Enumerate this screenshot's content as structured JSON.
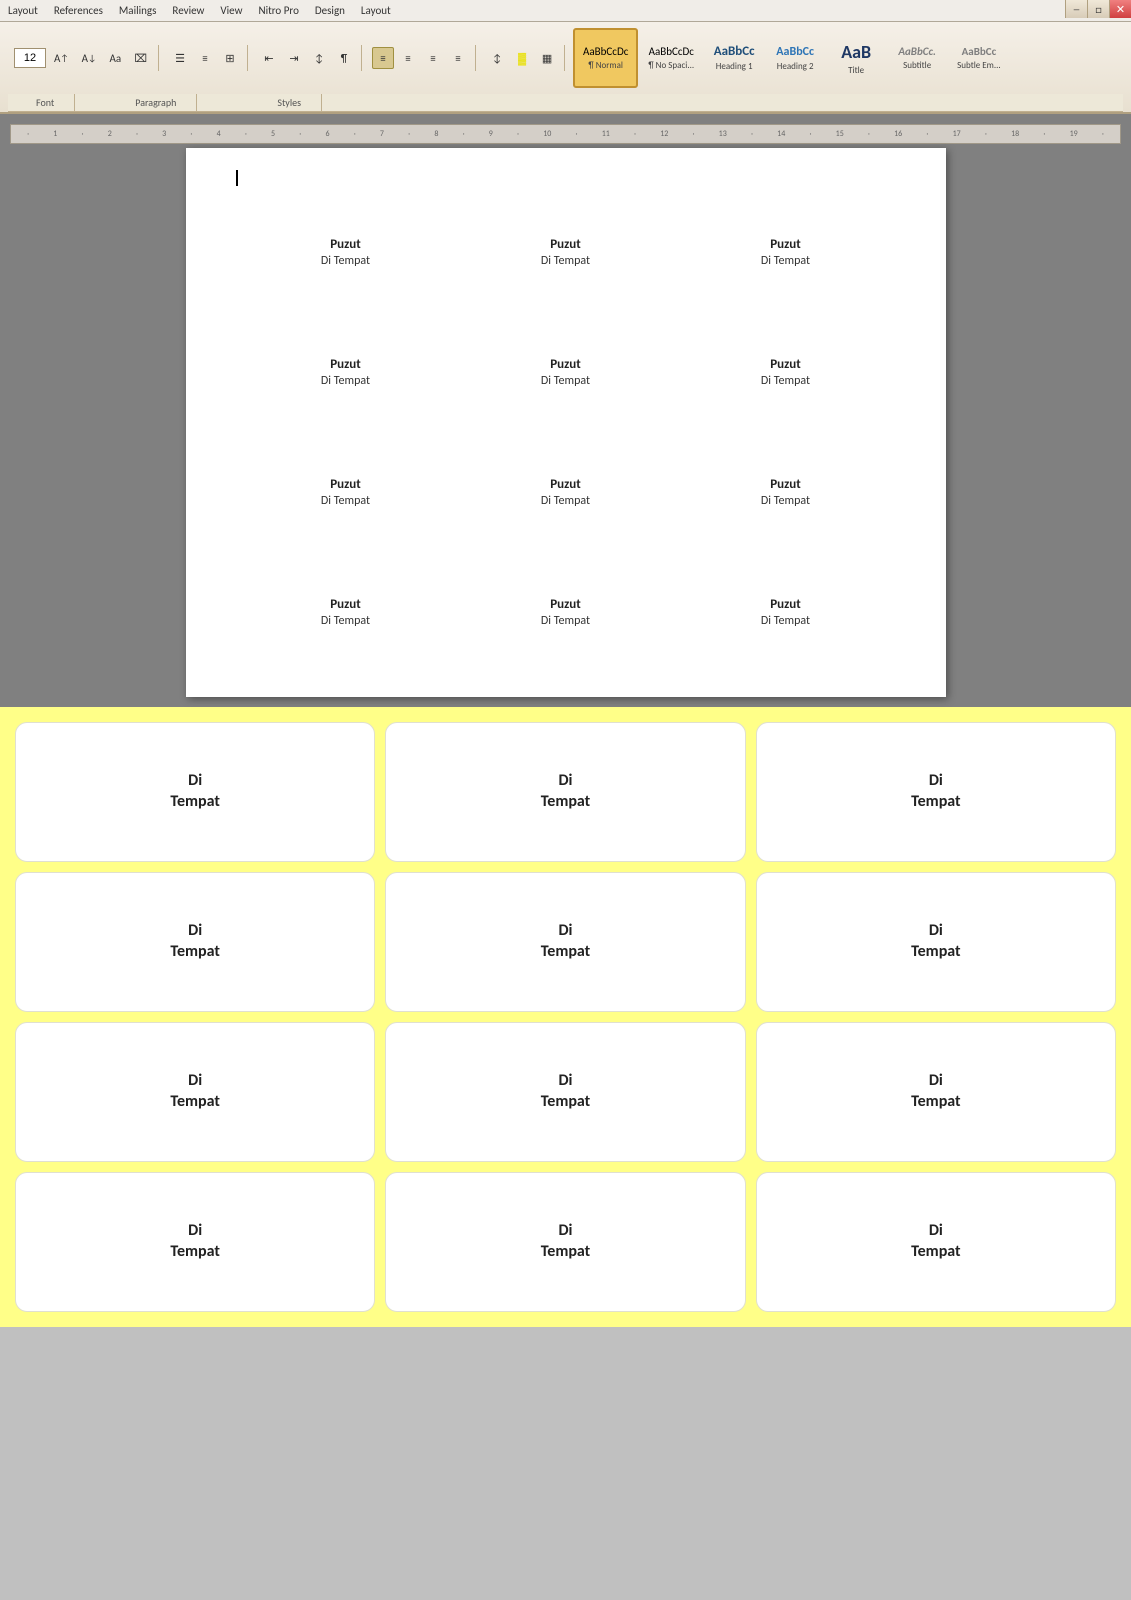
{
  "menubar": {
    "items": [
      "Layout",
      "References",
      "Mailings",
      "Review",
      "View",
      "Nitro Pro",
      "Design",
      "Layout"
    ]
  },
  "ribbon": {
    "font_size": "12",
    "font_group_label": "Font",
    "paragraph_group_label": "Paragraph",
    "styles_group_label": "Styles",
    "styles": [
      {
        "id": "normal",
        "preview": "AaBbCcDc",
        "label": "¶ Normal",
        "active": true
      },
      {
        "id": "no-spacing",
        "preview": "AaBbCcDc",
        "label": "¶ No Spaci...",
        "active": false
      },
      {
        "id": "heading1",
        "preview": "AaBbCc",
        "label": "Heading 1",
        "active": false
      },
      {
        "id": "heading2",
        "preview": "AaBbCc",
        "label": "Heading 2",
        "active": false
      },
      {
        "id": "title",
        "preview": "AaB",
        "label": "Title",
        "active": false
      },
      {
        "id": "subtitle",
        "preview": "AaBbCc.",
        "label": "Subtitle",
        "active": false
      },
      {
        "id": "subtle-em",
        "preview": "AaBbCc",
        "label": "Subtle Em...",
        "active": false
      }
    ]
  },
  "document": {
    "rows": [
      {
        "cells": [
          {
            "title": "Puzut",
            "subtitle": "Di Tempat"
          },
          {
            "title": "Puzut",
            "subtitle": "Di Tempat"
          },
          {
            "title": "Puzut",
            "subtitle": "Di Tempat"
          }
        ]
      },
      {
        "cells": [
          {
            "title": "Puzut",
            "subtitle": "Di Tempat"
          },
          {
            "title": "Puzut",
            "subtitle": "Di Tempat"
          },
          {
            "title": "Puzut",
            "subtitle": "Di Tempat"
          }
        ]
      },
      {
        "cells": [
          {
            "title": "Puzut",
            "subtitle": "Di Tempat"
          },
          {
            "title": "Puzut",
            "subtitle": "Di Tempat"
          },
          {
            "title": "Puzut",
            "subtitle": "Di Tempat"
          }
        ]
      },
      {
        "cells": [
          {
            "title": "Puzut",
            "subtitle": "Di Tempat"
          },
          {
            "title": "Puzut",
            "subtitle": "Di Tempat"
          },
          {
            "title": "Puzut",
            "subtitle": "Di Tempat"
          }
        ]
      }
    ]
  },
  "stickers": {
    "rows": [
      [
        {
          "line1": "Di",
          "line2": "Tempat"
        },
        {
          "line1": "Di",
          "line2": "Tempat"
        },
        {
          "line1": "Di",
          "line2": "Tempat"
        }
      ],
      [
        {
          "line1": "Di",
          "line2": "Tempat"
        },
        {
          "line1": "Di",
          "line2": "Tempat"
        },
        {
          "line1": "Di",
          "line2": "Tempat"
        }
      ],
      [
        {
          "line1": "Di",
          "line2": "Tempat"
        },
        {
          "line1": "Di",
          "line2": "Tempat"
        },
        {
          "line1": "Di",
          "line2": "Tempat"
        }
      ],
      [
        {
          "line1": "Di",
          "line2": "Tempat"
        },
        {
          "line1": "Di",
          "line2": "Tempat"
        },
        {
          "line1": "Di",
          "line2": "Tempat"
        }
      ]
    ]
  },
  "window_controls": {
    "minimize": "─",
    "maximize": "□",
    "close": "✕"
  },
  "taskbar": {
    "items": [
      "",
      "",
      "",
      "",
      ""
    ],
    "systray": [
      "◀",
      "●",
      "♪"
    ]
  }
}
